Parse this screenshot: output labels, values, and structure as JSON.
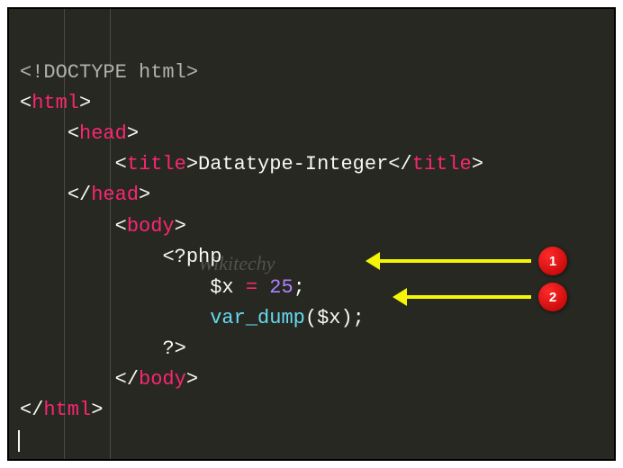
{
  "code": {
    "l1_doctype": "<!DOCTYPE html>",
    "l2_open_b1": "<",
    "l2_tag": "html",
    "l2_open_b2": ">",
    "l3_open_b1": "<",
    "l3_tag": "head",
    "l3_open_b2": ">",
    "l4_open_b1": "<",
    "l4_tag": "title",
    "l4_open_b2": ">",
    "l4_text": "Datatype-Integer",
    "l4_close_b1": "</",
    "l4_close_b2": ">",
    "l5_close_b1": "</",
    "l5_tag": "head",
    "l5_close_b2": ">",
    "l6_open_b1": "<",
    "l6_tag": "body",
    "l6_open_b2": ">",
    "l7_php": "<?php",
    "l8_var": "$x",
    "l8_eq": " = ",
    "l8_num": "25",
    "l8_semi": ";",
    "l9_func": "var_dump",
    "l9_p1": "(",
    "l9_var": "$x",
    "l9_p2": ")",
    "l9_semi": ";",
    "l10_php_close": "?>",
    "l11_close_b1": "</",
    "l11_tag": "body",
    "l11_close_b2": ">",
    "l12_close_b1": "</",
    "l12_tag": "html",
    "l12_close_b2": ">"
  },
  "annotations": {
    "a1": "1",
    "a2": "2"
  },
  "watermark": "Wikitechy",
  "colors": {
    "bg": "#272822",
    "tag": "#f92672",
    "func": "#66d9ef",
    "num": "#ae81ff",
    "arrow": "#f5f50a"
  }
}
